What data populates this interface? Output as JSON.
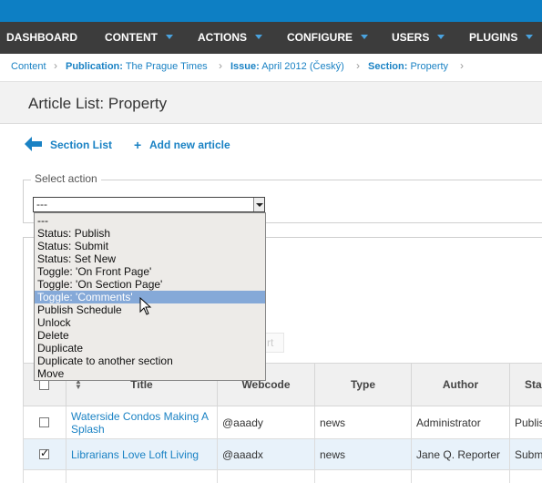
{
  "nav": {
    "items": [
      {
        "label": "DASHBOARD",
        "has_caret": false
      },
      {
        "label": "CONTENT",
        "has_caret": true
      },
      {
        "label": "ACTIONS",
        "has_caret": true
      },
      {
        "label": "CONFIGURE",
        "has_caret": true
      },
      {
        "label": "USERS",
        "has_caret": true
      },
      {
        "label": "PLUGINS",
        "has_caret": true
      }
    ]
  },
  "breadcrumb": {
    "content": "Content",
    "publication_label": "Publication:",
    "publication_value": "The Prague Times",
    "issue_label": "Issue:",
    "issue_value": "April 2012 (Český)",
    "section_label": "Section:",
    "section_value": "Property",
    "separator": "›"
  },
  "page": {
    "title": "Article List: Property"
  },
  "actions": {
    "section_list": "Section List",
    "add_new_article": "Add new article"
  },
  "select_action": {
    "legend": "Select action",
    "value": "---",
    "options": [
      "---",
      "Status: Publish",
      "Status: Submit",
      "Status: Set New",
      "Toggle: 'On Front Page'",
      "Toggle: 'On Section Page'",
      "Toggle: 'Comments'",
      "Publish Schedule",
      "Unlock",
      "Delete",
      "Duplicate",
      "Duplicate to another section",
      "Move"
    ],
    "highlighted_option": "Toggle: 'Comments'"
  },
  "hidden_button_fragment": "rt",
  "table": {
    "columns": [
      "Title",
      "Webcode",
      "Type",
      "Author",
      "Sta"
    ],
    "rows": [
      {
        "checked": false,
        "title": "Waterside Condos Making A Splash",
        "webcode": "@aaady",
        "type": "news",
        "author": "Administrator",
        "status": "Publis"
      },
      {
        "checked": true,
        "title": "Librarians Love Loft Living",
        "webcode": "@aaadx",
        "type": "news",
        "author": "Jane Q. Reporter",
        "status": "Subm"
      }
    ]
  },
  "colors": {
    "brand_blue": "#0d7fc4",
    "nav_bg": "#3c3c3c",
    "link": "#1a82c4",
    "highlight": "#85a9d8",
    "selected_row": "#e8f2fa"
  }
}
